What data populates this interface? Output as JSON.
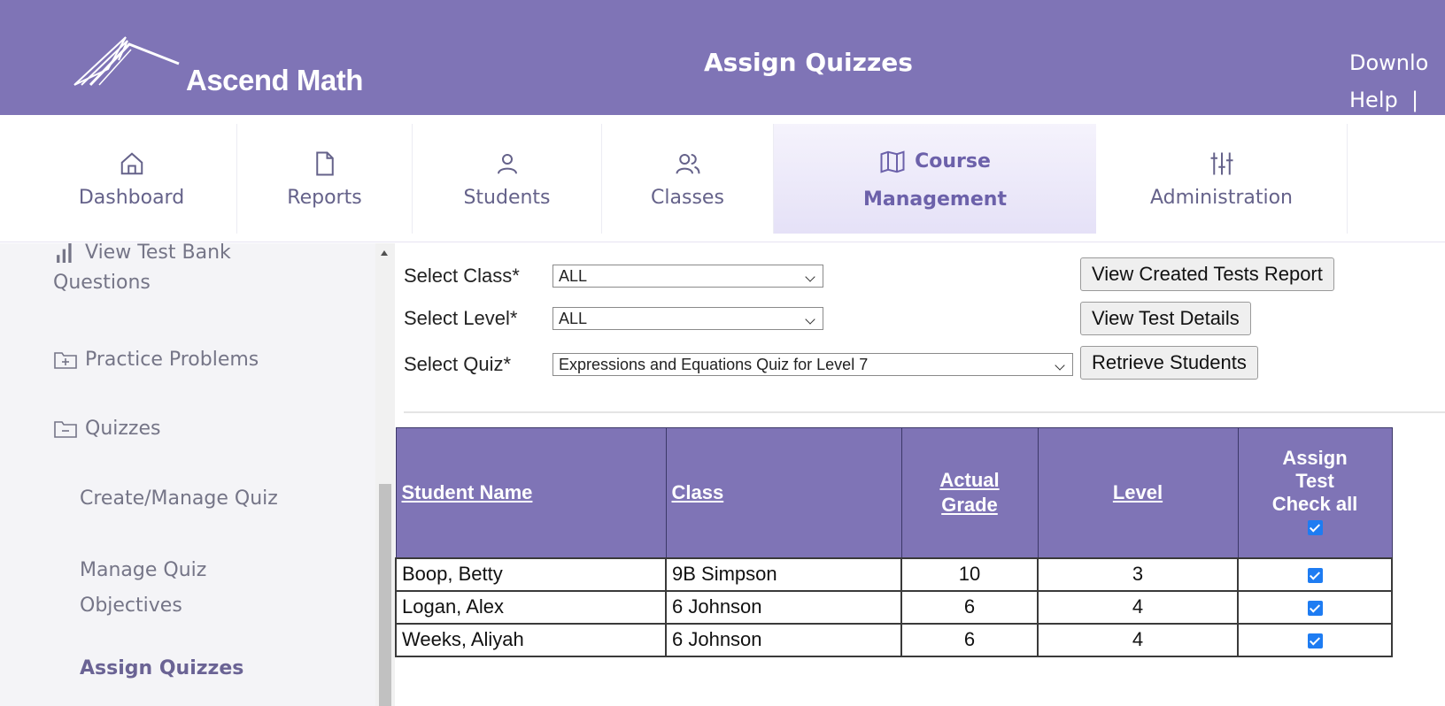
{
  "header": {
    "brand": "Ascend Math",
    "title": "Assign Quizzes",
    "links": [
      "Downlo",
      "Help  |"
    ]
  },
  "nav": [
    {
      "label": "Dashboard",
      "icon": "home-icon"
    },
    {
      "label": "Reports",
      "icon": "document-icon"
    },
    {
      "label": "Students",
      "icon": "user-icon"
    },
    {
      "label": "Classes",
      "icon": "users-icon"
    },
    {
      "label_top": "Course",
      "label_bottom": "Management",
      "icon": "map-icon",
      "active": true
    },
    {
      "label": "Administration",
      "icon": "sliders-icon"
    }
  ],
  "sidebar": {
    "items": [
      {
        "label_top": "View Test Bank",
        "label_bottom": "Questions",
        "icon": "bar-chart-icon"
      },
      {
        "label": "Practice Problems",
        "icon": "folder-plus-icon"
      },
      {
        "label": "Quizzes",
        "icon": "folder-minus-icon"
      },
      {
        "label": "Create/Manage Quiz"
      },
      {
        "label_top": "Manage Quiz",
        "label_bottom": "Objectives"
      },
      {
        "label": "Assign Quizzes",
        "active": true
      }
    ]
  },
  "form": {
    "class_label": "Select Class*",
    "class_value": "ALL",
    "level_label": "Select Level*",
    "level_value": "ALL",
    "quiz_label": "Select Quiz*",
    "quiz_value": "Expressions and Equations Quiz for Level 7",
    "btn_report": "View Created Tests Report",
    "btn_details": "View Test Details",
    "btn_retrieve": "Retrieve Students"
  },
  "table": {
    "headers": {
      "name": "Student Name",
      "class": "Class",
      "grade_top": "Actual",
      "grade_bottom": "Grade",
      "level": "Level",
      "assign_1": "Assign",
      "assign_2": "Test",
      "assign_3": "Check all"
    },
    "rows": [
      {
        "name": "Boop, Betty",
        "class": "9B Simpson",
        "grade": "10",
        "level": "3",
        "assigned": true
      },
      {
        "name": "Logan, Alex",
        "class": "6 Johnson",
        "grade": "6",
        "level": "4",
        "assigned": true
      },
      {
        "name": "Weeks, Aliyah",
        "class": "6 Johnson",
        "grade": "6",
        "level": "4",
        "assigned": true
      }
    ]
  }
}
